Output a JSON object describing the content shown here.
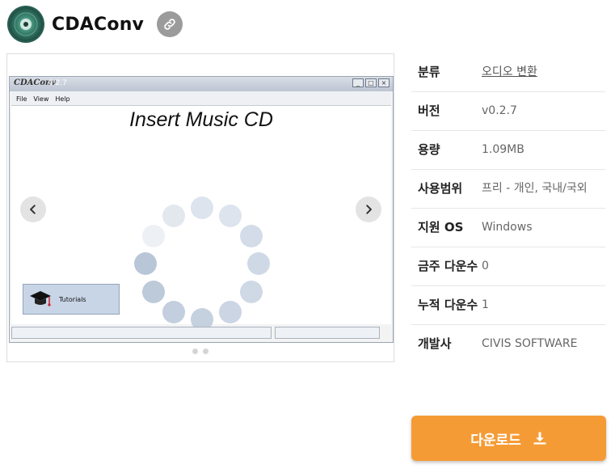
{
  "header": {
    "app_name": "CDAConv",
    "app_icon": "cd-disc-icon",
    "link_icon": "link-icon"
  },
  "gallery": {
    "screenshot": {
      "logo": "CDAConv",
      "version": "0.2.7",
      "menu": [
        "File",
        "View",
        "Help"
      ],
      "headline": "Insert Music CD",
      "tutorials_label": "Tutorials"
    },
    "slides": 2,
    "prev_icon": "chevron-left-icon",
    "next_icon": "chevron-right-icon"
  },
  "info": {
    "rows": [
      {
        "key": "분류",
        "value": "오디오 변환"
      },
      {
        "key": "버전",
        "value": "v0.2.7"
      },
      {
        "key": "용량",
        "value": "1.09MB"
      },
      {
        "key": "사용범위",
        "value": "프리 - 개인, 국내/국외"
      },
      {
        "key": "지원 OS",
        "value": "Windows"
      },
      {
        "key": "금주 다운수",
        "value": "0"
      },
      {
        "key": "누적 다운수",
        "value": "1"
      },
      {
        "key": "개발사",
        "value": "CIVIS SOFTWARE"
      }
    ]
  },
  "download": {
    "label": "다운로드",
    "icon": "download-icon",
    "color": "#f59b35"
  }
}
